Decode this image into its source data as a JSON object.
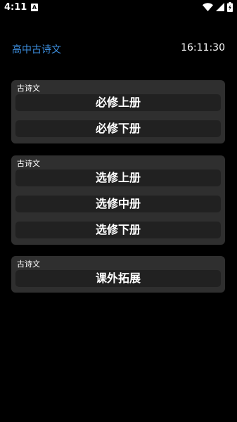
{
  "status_bar": {
    "time": "4:11",
    "notification_icon": "a-badge-icon",
    "icons": [
      "wifi-icon",
      "signal-icon",
      "battery-charging-icon"
    ]
  },
  "header": {
    "title": "高中古诗文",
    "clock": "16:11:30"
  },
  "groups": [
    {
      "label": "古诗文",
      "buttons": [
        "必修上册",
        "必修下册"
      ]
    },
    {
      "label": "古诗文",
      "buttons": [
        "选修上册",
        "选修中册",
        "选修下册"
      ]
    },
    {
      "label": "古诗文",
      "buttons": [
        "课外拓展"
      ]
    }
  ],
  "colors": {
    "background": "#000000",
    "accent": "#3d8fe0",
    "group_bg": "#2f2f2f",
    "button_bg": "#212121"
  }
}
